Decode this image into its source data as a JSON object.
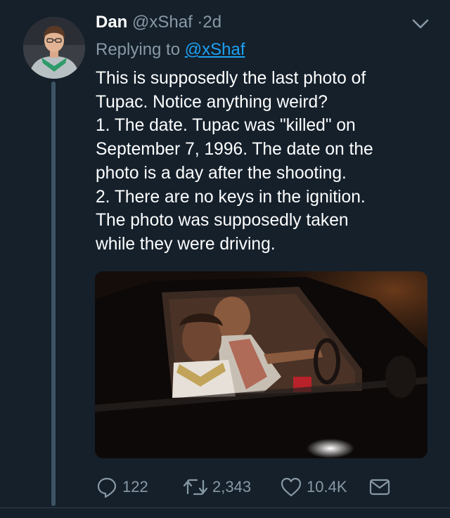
{
  "tweet": {
    "display_name": "Dan",
    "handle": "@xShaf",
    "separator": "·",
    "timestamp": "2d",
    "replying_prefix": "Replying to",
    "replying_handle": "@xShaf",
    "text_lines": [
      "This is supposedly the last photo of",
      "Tupac. Notice anything weird?",
      "1. The date. Tupac was \"killed\" on",
      "September 7, 1996. The date on the",
      "photo is a day after the shooting.",
      "2. There are no keys in the ignition.",
      "The photo was supposedly taken",
      "while they were driving."
    ],
    "media": {
      "description_icon": "photo-of-two-men-in-car"
    }
  },
  "actions": {
    "reply_count": "122",
    "retweet_count": "2,343",
    "like_count": "10.4K"
  },
  "icons": {
    "menu": "chevron-down-icon",
    "reply": "reply-icon",
    "retweet": "retweet-icon",
    "like": "heart-icon",
    "dm": "envelope-icon"
  },
  "colors": {
    "background": "#15202b",
    "secondary_text": "#8899a6",
    "link": "#1da1f2",
    "thread_line": "#3d5466"
  }
}
